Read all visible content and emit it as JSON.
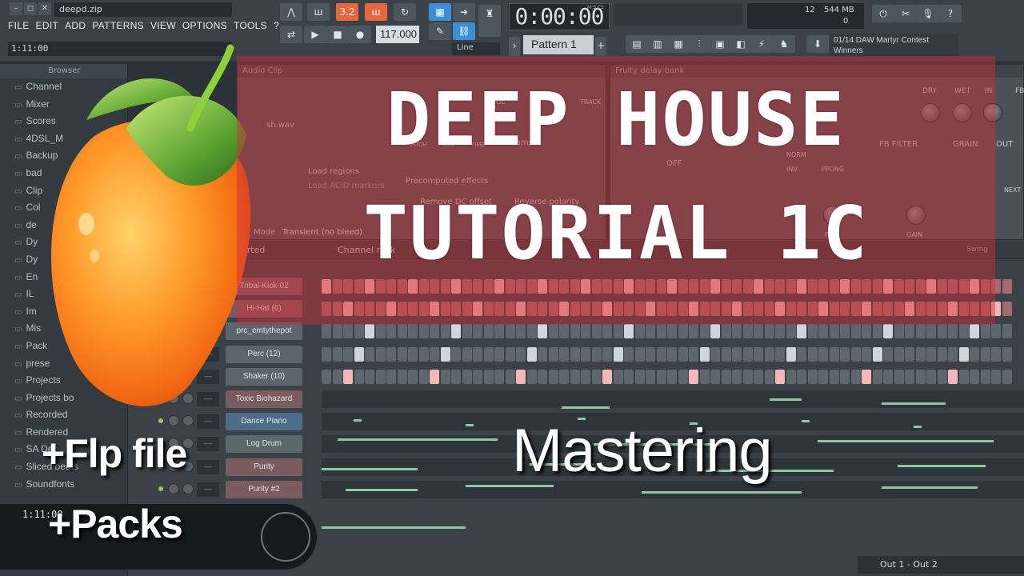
{
  "window": {
    "title": "deepd.zip"
  },
  "menu": [
    "FILE",
    "EDIT",
    "ADD",
    "PATTERNS",
    "VIEW",
    "OPTIONS",
    "TOOLS",
    "?"
  ],
  "transport": {
    "song_position": "1:11:00",
    "time_display": "0:00:00",
    "time_sub": "M:S:CS",
    "tempo": "117.000",
    "pattern_label": "Pattern 1",
    "snap_label": "Line",
    "cpu_value": "12",
    "ram_value": "544 MB",
    "poly_value": "0",
    "rec_label": "3.2"
  },
  "news": {
    "line1": "01/14  DAW Martyr Contest",
    "line2": "Winners"
  },
  "browser": {
    "header": "Browser",
    "items": [
      "Channel",
      "Mixer",
      "Scores",
      "4DSL_M",
      "Backup",
      "bad",
      "Clip",
      "Col",
      "de",
      "Dy",
      "Dy",
      "En",
      "IL",
      "Im",
      "Mis",
      "Pack",
      "prese",
      "Projects",
      "Projects bo",
      "Recorded",
      "Rendered",
      "SA Dee",
      "Sliced beats",
      "Soundfonts"
    ]
  },
  "win_left": {
    "title": "Audio Clip",
    "file": "sh.wav",
    "load_regions": "Load regions",
    "load_acid": "Load ACID markers",
    "precomputed": "Precomputed effects",
    "remove_dc": "Remove DC offset",
    "reverse_polarity": "Reverse polarity",
    "mode_label": "Mode",
    "mode_value": "Transient (no bleed)",
    "resample": "Resample",
    "vol": "VOL",
    "track": "TRACK",
    "pitch": "PITCH",
    "mul": "MUL",
    "time": "TIME"
  },
  "win_right": {
    "title": "Fruity delay bank",
    "dry": "DRY",
    "wet": "WET",
    "in": "IN",
    "fb": "FB",
    "fb_filter": "FB FILTER",
    "grain": "GRAIN",
    "out": "OUT",
    "off": "OFF",
    "norm": "NORM",
    "inv": "INV",
    "ppong": "PPONG",
    "pan": "PAN",
    "gain": "GAIN",
    "next": "NEXT"
  },
  "rack": {
    "title": "Channel rack",
    "filter": "orted",
    "swing_label": "Swing",
    "channels": [
      {
        "name": "Tribal-Kick-02",
        "style": "pink",
        "steps": [
          1,
          0,
          0,
          0,
          1,
          0,
          0,
          0,
          1,
          0,
          0,
          0,
          1,
          0,
          0,
          0,
          1,
          0,
          0,
          0,
          1,
          0,
          0,
          0,
          1,
          0,
          0,
          0,
          1,
          0,
          0,
          0,
          1,
          0,
          0,
          0,
          1,
          0,
          0,
          0,
          1,
          0,
          0,
          0,
          1,
          0,
          0,
          0,
          1,
          0,
          0,
          0,
          1,
          0,
          0,
          0,
          1,
          0,
          0,
          0,
          1,
          0,
          0,
          0
        ],
        "color": "red"
      },
      {
        "name": "Hi-Hat (6)",
        "style": "pink",
        "steps": [
          0,
          0,
          1,
          0,
          0,
          0,
          1,
          0,
          0,
          0,
          1,
          0,
          0,
          0,
          1,
          0,
          0,
          0,
          1,
          0,
          0,
          0,
          1,
          0,
          0,
          0,
          1,
          0,
          0,
          0,
          1,
          0,
          0,
          0,
          1,
          0,
          0,
          0,
          1,
          0,
          0,
          0,
          1,
          0,
          0,
          0,
          1,
          0,
          0,
          0,
          1,
          0,
          0,
          0,
          1,
          0,
          0,
          0,
          1,
          0,
          0,
          0,
          1,
          0
        ],
        "color": "red"
      },
      {
        "name": "prc_emtythepot",
        "style": "",
        "steps": [
          0,
          0,
          0,
          0,
          1,
          0,
          0,
          0,
          0,
          0,
          0,
          0,
          1,
          0,
          0,
          0,
          0,
          0,
          0,
          0,
          1,
          0,
          0,
          0,
          0,
          0,
          0,
          0,
          1,
          0,
          0,
          0,
          0,
          0,
          0,
          0,
          1,
          0,
          0,
          0,
          0,
          0,
          0,
          0,
          1,
          0,
          0,
          0,
          0,
          0,
          0,
          0,
          1,
          0,
          0,
          0,
          0,
          0,
          0,
          0,
          1,
          0,
          0,
          0
        ],
        "color": "grey"
      },
      {
        "name": "Perc (12)",
        "style": "",
        "steps": [
          0,
          0,
          0,
          1,
          0,
          0,
          0,
          0,
          0,
          0,
          0,
          1,
          0,
          0,
          0,
          0,
          0,
          0,
          0,
          1,
          0,
          0,
          0,
          0,
          0,
          0,
          0,
          1,
          0,
          0,
          0,
          0,
          0,
          0,
          0,
          1,
          0,
          0,
          0,
          0,
          0,
          0,
          0,
          1,
          0,
          0,
          0,
          0,
          0,
          0,
          0,
          1,
          0,
          0,
          0,
          0,
          0,
          0,
          0,
          1,
          0,
          0,
          0,
          0
        ],
        "color": "grey"
      },
      {
        "name": "Shaker (10)",
        "style": "",
        "steps": [
          0,
          0,
          1,
          0,
          0,
          0,
          0,
          0,
          0,
          0,
          1,
          0,
          0,
          0,
          0,
          0,
          0,
          0,
          1,
          0,
          0,
          0,
          0,
          0,
          0,
          0,
          1,
          0,
          0,
          0,
          0,
          0,
          0,
          0,
          1,
          0,
          0,
          0,
          0,
          0,
          0,
          0,
          1,
          0,
          0,
          0,
          0,
          0,
          0,
          0,
          1,
          0,
          0,
          0,
          0,
          0,
          0,
          0,
          1,
          0,
          0,
          0,
          0,
          0
        ],
        "color": "pinkish"
      },
      {
        "name": "Toxic Biohazard",
        "style": "pink",
        "steps": null
      },
      {
        "name": "Dance Piano",
        "style": "blue",
        "steps": null
      },
      {
        "name": "Log Drum",
        "style": "green",
        "steps": null
      },
      {
        "name": "Purity",
        "style": "pink",
        "steps": null
      },
      {
        "name": "Purity #2",
        "style": "pink",
        "steps": null
      }
    ]
  },
  "overlay": {
    "title_line1": "DEEP HOUSE",
    "title_line2": "TUTORIAL 1C",
    "subtitle": "Mastering",
    "caption1": "+Flp file",
    "caption2": "+Packs",
    "pill_time": "1:11:00"
  },
  "output": "Out 1 - Out 2",
  "colors": {
    "accent_orange": "#e8663c",
    "accent_blue": "#3c8fd4",
    "overlay_red": "#d22d37"
  }
}
